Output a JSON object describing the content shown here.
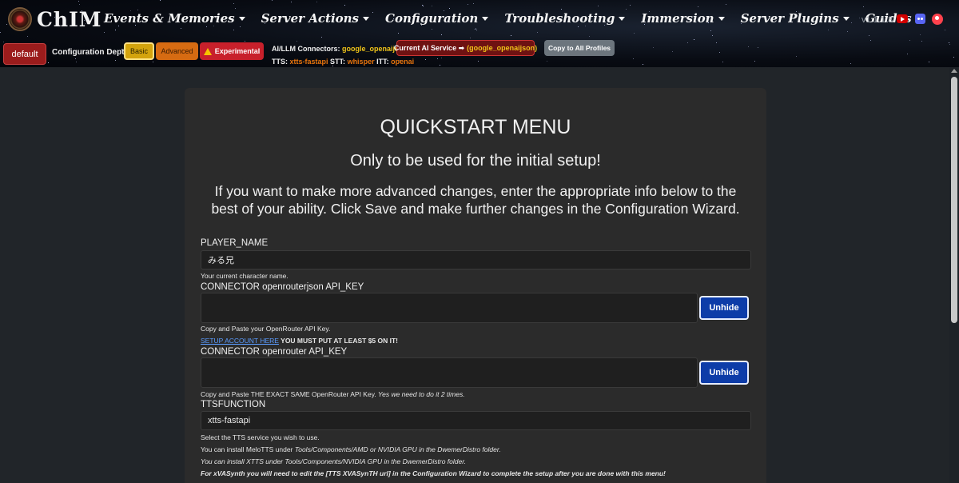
{
  "header": {
    "logo_text": "ChIM",
    "nav": [
      {
        "label": "Events & Memories"
      },
      {
        "label": "Server Actions"
      },
      {
        "label": "Configuration"
      },
      {
        "label": "Troubleshooting"
      },
      {
        "label": "Immersion"
      },
      {
        "label": "Server Plugins"
      },
      {
        "label": "Guides"
      }
    ],
    "version": "v1.1.1.3"
  },
  "profile_bar": {
    "profile_button": "default",
    "config_depth_label": "Configuration Depth",
    "depth_buttons": {
      "basic": "Basic",
      "advanced": "Advanced",
      "experimental": "Experimental"
    },
    "connectors_label": "AI/LLM Connectors:",
    "connectors_value": "google_openaijson |",
    "current_ai_label": "Current AI Service ➡",
    "current_ai_value": "(google_openaijson)",
    "copy_button": "Copy to All Profiles",
    "tts_label": "TTS:",
    "tts_value": "xtts-fastapi",
    "stt_label": "STT:",
    "stt_value": "whisper",
    "itt_label": "ITT:",
    "itt_value": "openai"
  },
  "main": {
    "title": "QUICKSTART MENU",
    "subtitle": "Only to be used for the initial setup!",
    "info_line1": "If you want to make more advanced changes, enter the appropriate info below to the",
    "info_line2": "best of your ability. Click Save and make further changes in the Configuration Wizard.",
    "fields": {
      "player_name": {
        "label": "PLAYER_NAME",
        "value": "みる兄",
        "help": "Your current character name."
      },
      "openrouterjson_key": {
        "label": "CONNECTOR openrouterjson API_KEY",
        "value": "",
        "button": "Unhide",
        "help": "Copy and Paste your OpenRouter API Key.",
        "link": "SETUP ACCOUNT HERE",
        "warning": " YOU MUST PUT AT LEAST $5 ON IT!"
      },
      "openrouter_key": {
        "label": "CONNECTOR openrouter API_KEY",
        "value": "",
        "button": "Unhide",
        "help": "Copy and Paste THE EXACT SAME OpenRouter API Key.",
        "help_italic": " Yes we need to do it 2 times."
      },
      "ttsfunction": {
        "label": "TTSFUNCTION",
        "value": "xtts-fastapi",
        "help1": "Select the TTS service you wish to use.",
        "help2_pre": "You can install MeloTTS under ",
        "help2_italic": "Tools/Components/AMD or NVIDIA GPU in the DwemerDistro folder.",
        "help3_italic": "You can install XTTS under Tools/Components/NVIDIA GPU in the DwemerDistro folder.",
        "help4_boldital": "For xVASynth you will need to edit the [TTS XVASynTH url] in the Configuration Wizard to complete the setup after you are done with this menu!"
      }
    }
  },
  "icons": {
    "youtube": "youtube-icon",
    "discord": "discord-icon",
    "patreon": "patreon-icon"
  },
  "colors": {
    "accent_yellow": "#f0c419",
    "accent_orange": "#e8740c",
    "profile_red": "#9b1c1c",
    "unhide_blue": "#0d3ca8"
  }
}
